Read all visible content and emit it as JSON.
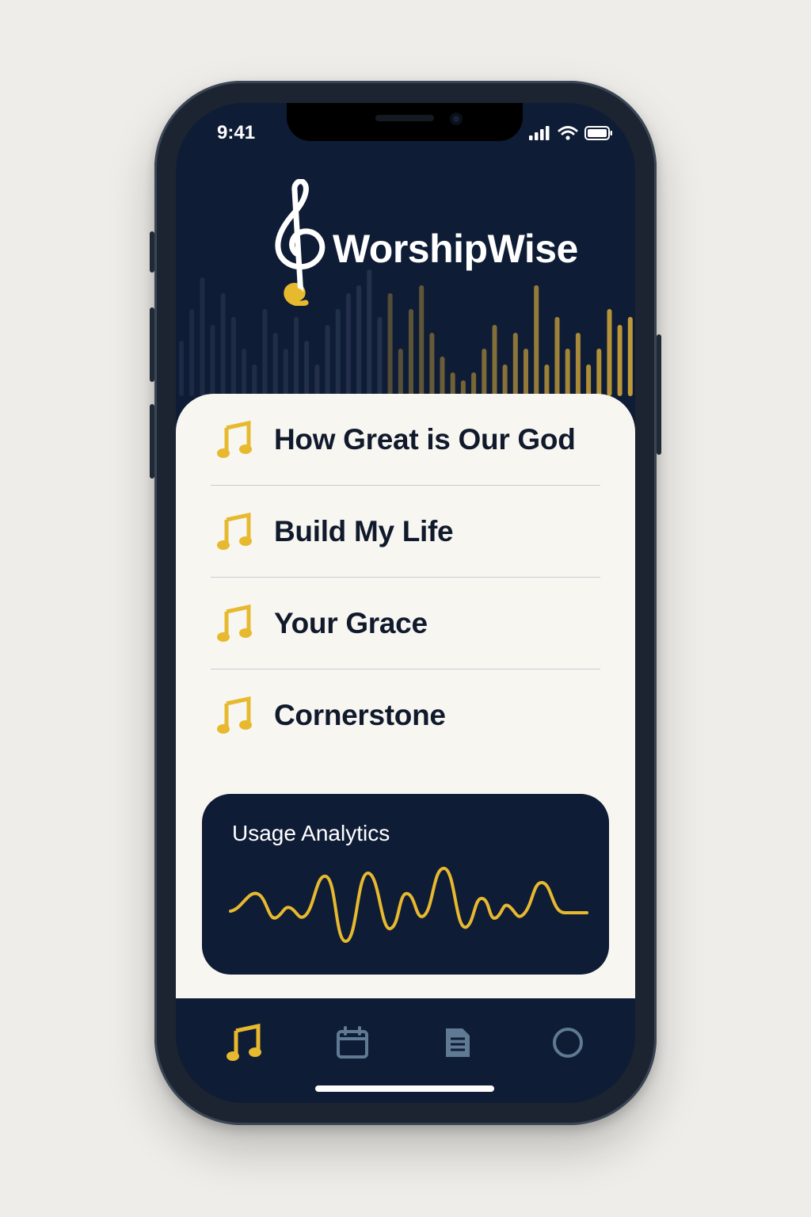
{
  "status_bar": {
    "time": "9:41",
    "icons": [
      "signal-icon",
      "wifi-icon",
      "battery-icon"
    ]
  },
  "header": {
    "app_name": "WorshipWise",
    "logo_icon": "treble-clef-icon"
  },
  "songs": [
    {
      "title": "How Great is Our God",
      "icon": "music-note-icon"
    },
    {
      "title": "Build My Life",
      "icon": "music-note-icon"
    },
    {
      "title": "Your Grace",
      "icon": "music-note-icon"
    },
    {
      "title": "Cornerstone",
      "icon": "music-note-icon"
    }
  ],
  "analytics": {
    "title": "Usage Analytics"
  },
  "tabbar": {
    "tabs": [
      {
        "icon": "music-note-icon",
        "active": true
      },
      {
        "icon": "calendar-icon",
        "active": false
      },
      {
        "icon": "document-icon",
        "active": false
      },
      {
        "icon": "profile-circle-icon",
        "active": false
      }
    ]
  },
  "colors": {
    "navy": "#0f1c36",
    "gold": "#e7b92f",
    "card": "#f8f6f1",
    "muted_icon": "#5f7a92"
  }
}
